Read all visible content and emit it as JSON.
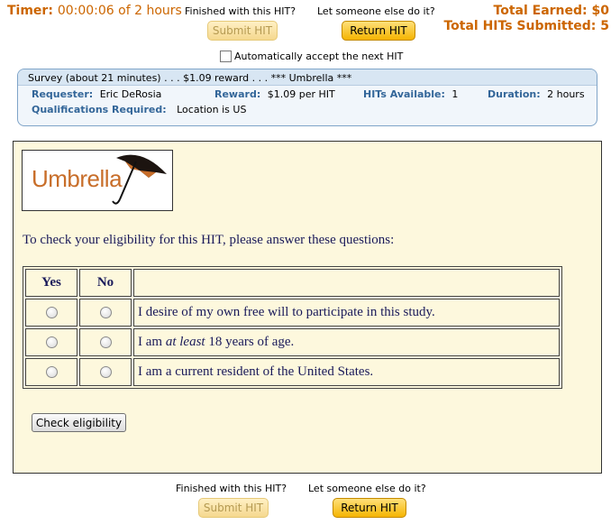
{
  "header": {
    "timer_label": "Timer:",
    "timer_value": "00:00:06 of 2 hours",
    "finished_text": "Finished with this HIT?",
    "let_someone_text": "Let someone else do it?",
    "submit_label": "Submit HIT",
    "return_label": "Return HIT",
    "total_earned_label": "Total Earned:",
    "total_earned_value": "$0",
    "total_hits_label": "Total HITs Submitted:",
    "total_hits_value": "5",
    "auto_accept_label": "Automatically accept the next HIT"
  },
  "hit": {
    "title": "Survey (about 21 minutes) . . . $1.09 reward . . . *** Umbrella ***",
    "requester_label": "Requester:",
    "requester_value": "Eric DeRosia",
    "reward_label": "Reward:",
    "reward_value": "$1.09 per HIT",
    "available_label": "HITs Available:",
    "available_value": "1",
    "duration_label": "Duration:",
    "duration_value": "2 hours",
    "qual_label": "Qualifications Required:",
    "qual_value": "Location is US"
  },
  "survey": {
    "logo_text": "Umbrella",
    "instructions": "To check your eligibility for this HIT, please answer these questions:",
    "col_yes": "Yes",
    "col_no": "No",
    "q1": "I desire of my own free will to participate in this study.",
    "q2_pre": "I am ",
    "q2_em": "at least",
    "q2_post": " 18 years of age.",
    "q3": "I am a current resident of the United States.",
    "check_label": "Check eligibility"
  },
  "footer": {
    "finished_text": "Finished with this HIT?",
    "let_someone_text": "Let someone else do it?",
    "submit_label": "Submit HIT",
    "return_label": "Return HIT"
  },
  "colors": {
    "accent": "#cc6600",
    "label_blue": "#336699",
    "panel_bg": "#fdf8dd",
    "text_navy": "#1a1a5a"
  }
}
